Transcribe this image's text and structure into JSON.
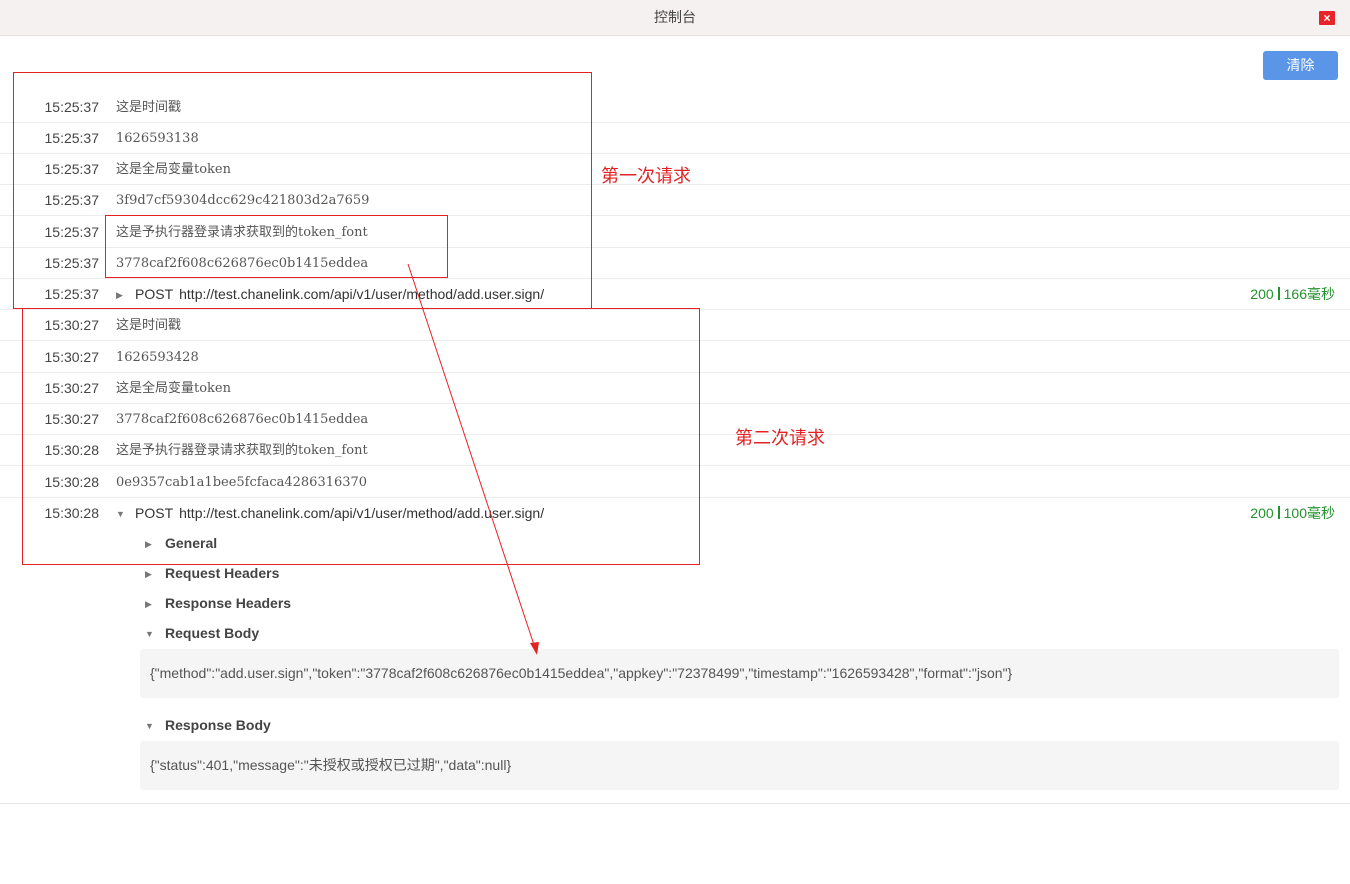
{
  "window": {
    "title": "控制台",
    "close_icon": "×"
  },
  "toolbar": {
    "clear_label": "清除"
  },
  "logs": [
    {
      "time": "15:25:37",
      "text": "这是时间戳"
    },
    {
      "time": "15:25:37",
      "text": "1626593138"
    },
    {
      "time": "15:25:37",
      "text": "这是全局变量token"
    },
    {
      "time": "15:25:37",
      "text": "3f9d7cf59304dcc629c421803d2a7659"
    },
    {
      "time": "15:25:37",
      "text": "这是予执行器登录请求获取到的token_font"
    },
    {
      "time": "15:25:37",
      "text": "3778caf2f608c626876ec0b1415eddea"
    },
    {
      "time": "15:25:37",
      "method": "POST",
      "url": "http://test.chanelink.com/api/v1/user/method/add.user.sign/",
      "status": "200",
      "duration": "166毫秒"
    },
    {
      "time": "15:30:27",
      "text": "这是时间戳"
    },
    {
      "time": "15:30:27",
      "text": "1626593428"
    },
    {
      "time": "15:30:27",
      "text": "这是全局变量token"
    },
    {
      "time": "15:30:27",
      "text": "3778caf2f608c626876ec0b1415eddea"
    },
    {
      "time": "15:30:28",
      "text": "这是予执行器登录请求获取到的token_font"
    },
    {
      "time": "15:30:28",
      "text": "0e9357cab1a1bee5fcfaca4286316370"
    },
    {
      "time": "15:30:28",
      "method": "POST",
      "url": "http://test.chanelink.com/api/v1/user/method/add.user.sign/",
      "status": "200",
      "duration": "100毫秒"
    }
  ],
  "details": {
    "general": "General",
    "request_headers": "Request Headers",
    "response_headers": "Response Headers",
    "request_body_label": "Request Body",
    "request_body": "{\"method\":\"add.user.sign\",\"token\":\"3778caf2f608c626876ec0b1415eddea\",\"appkey\":\"72378499\",\"timestamp\":\"1626593428\",\"format\":\"json\"}",
    "response_body_label": "Response Body",
    "response_body": "{\"status\":401,\"message\":\"未授权或授权已过期\",\"data\":null}"
  },
  "annotations": {
    "first_request": "第一次请求",
    "second_request": "第二次请求",
    "color": "#e32323"
  },
  "colors": {
    "accent": "#5b95e8",
    "success": "#23912e",
    "close": "#e8242a"
  }
}
